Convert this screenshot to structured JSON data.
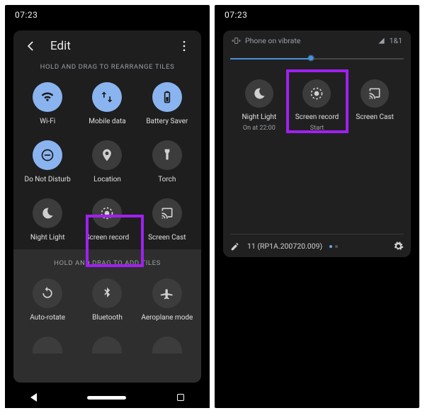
{
  "left": {
    "clock": "07:23",
    "title": "Edit",
    "hint_arrange": "HOLD AND DRAG TO REARRANGE TILES",
    "hint_add": "HOLD AND DRAG TO ADD TILES",
    "tiles_active": [
      {
        "id": "wifi",
        "label": "Wi-Fi",
        "icon": "wifi"
      },
      {
        "id": "mobile-data",
        "label": "Mobile data",
        "icon": "swap"
      },
      {
        "id": "battery-saver",
        "label": "Battery Saver",
        "icon": "battery"
      },
      {
        "id": "dnd",
        "label": "Do Not Disturb",
        "icon": "dnd"
      },
      {
        "id": "location",
        "label": "Location",
        "icon": "location"
      },
      {
        "id": "torch",
        "label": "Torch",
        "icon": "torch"
      },
      {
        "id": "night-light",
        "label": "Night Light",
        "icon": "moon"
      },
      {
        "id": "screen-record",
        "label": "Screen record",
        "icon": "record"
      },
      {
        "id": "screen-cast",
        "label": "Screen Cast",
        "icon": "cast"
      }
    ],
    "tiles_add": [
      {
        "id": "auto-rotate",
        "label": "Auto-rotate",
        "icon": "rotate"
      },
      {
        "id": "bluetooth",
        "label": "Bluetooth",
        "icon": "bluetooth"
      },
      {
        "id": "aeroplane",
        "label": "Aeroplane mode",
        "icon": "plane"
      }
    ]
  },
  "right": {
    "clock": "07:23",
    "ringer": "Phone on vibrate",
    "carrier": "1&1",
    "brightness_pct": 47,
    "tiles": [
      {
        "id": "night-light",
        "label": "Night Light",
        "sub": "On at 22:00",
        "icon": "moon"
      },
      {
        "id": "screen-record",
        "label": "Screen record",
        "sub": "Start",
        "icon": "record"
      },
      {
        "id": "screen-cast",
        "label": "Screen Cast",
        "sub": "",
        "icon": "cast"
      }
    ],
    "build": "11 (RP1A.200720.009)"
  }
}
